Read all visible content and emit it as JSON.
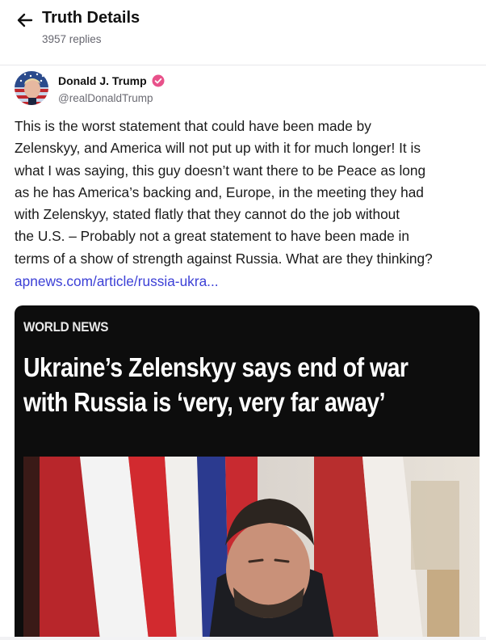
{
  "header": {
    "title": "Truth Details",
    "replies": "3957 replies",
    "back_icon": "arrow-left-icon"
  },
  "post": {
    "author": {
      "name": "Donald J. Trump",
      "handle": "@realDonaldTrump",
      "verified_icon": "verified-badge-icon",
      "verified_color": "#e8518a"
    },
    "text_lines": [
      "This is the worst statement that could have been made by",
      "Zelenskyy, and America will not put up with it for much longer! It is",
      "what I was saying, this guy doesn’t want there to be Peace as long",
      "as he has America’s backing and, Europe, in the meeting they had",
      "with Zelenskyy, stated flatly that they cannot do the job without",
      "the U.S. – Probably not a great statement to have been made in",
      "terms of a show of strength against Russia. What are they thinking?"
    ],
    "link_text": "apnews.com/article/russia-ukra...",
    "link_color": "#3b3fd6"
  },
  "card": {
    "section": "WORLD NEWS",
    "headline_lines": [
      "Ukraine’s Zelenskyy says end of war",
      "with Russia is ‘very, very far away’"
    ],
    "background": "#0d0d0d"
  }
}
